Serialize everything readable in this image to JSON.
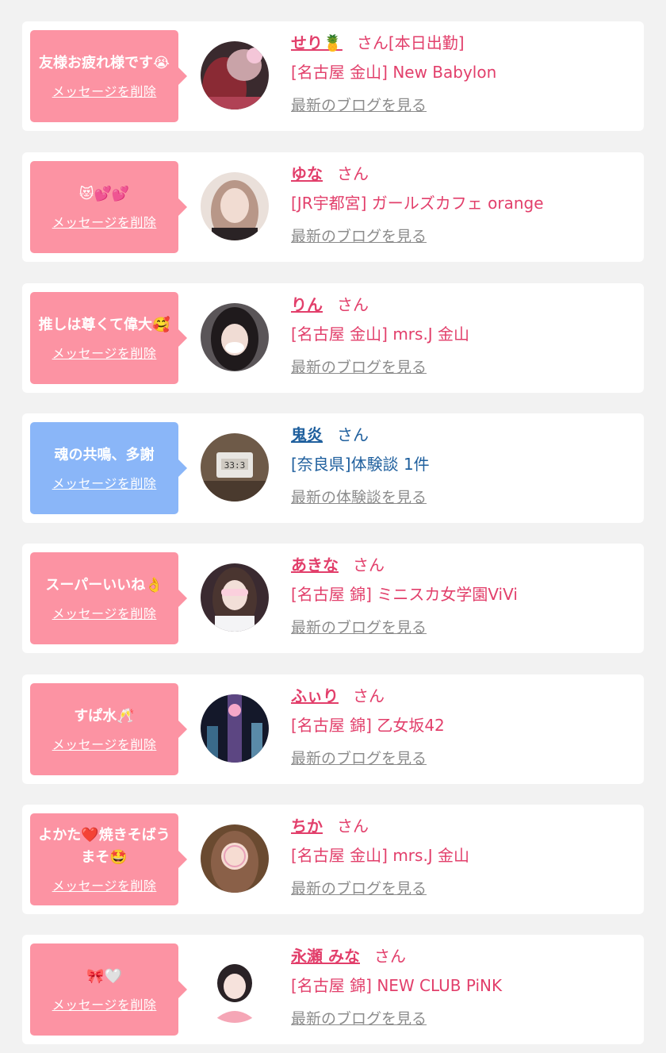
{
  "delete_label": "メッセージを削除",
  "colors": {
    "pink_bubble": "#fc93a3",
    "blue_bubble": "#8ab6f8",
    "pink_text": "#e23f6b",
    "blue_text": "#20609e",
    "link_gray": "#8c8c8c"
  },
  "items": [
    {
      "message": "友様お疲れ様です😭",
      "name": "せり🍍",
      "suffix": "さん[本日出勤]",
      "shop": "[名古屋 金山] New Babylon",
      "link": "最新のブログを見る",
      "theme": "pink",
      "avatar_icon": "girl-photo-red-hair"
    },
    {
      "message": "😻💕💕",
      "name": "ゆな",
      "suffix": "さん",
      "shop": "[JR宇都宮] ガールズカフェ orange",
      "link": "最新のブログを見る",
      "theme": "pink",
      "avatar_icon": "girl-photo-light"
    },
    {
      "message": "推しは尊くて偉大🥰",
      "name": "りん",
      "suffix": "さん",
      "shop": "[名古屋 金山] mrs.J 金山",
      "link": "最新のブログを見る",
      "theme": "pink",
      "avatar_icon": "girl-photo-dark-hair"
    },
    {
      "message": "魂の共鳴、多謝",
      "name": "鬼炎",
      "suffix": "さん",
      "shop": "[奈良県]体験談 1件",
      "link": "最新の体験談を見る",
      "theme": "blue",
      "avatar_icon": "clock-photo"
    },
    {
      "message": "スーパーいいね👌",
      "name": "あきな",
      "suffix": "さん",
      "shop": "[名古屋 錦] ミニスカ女学園ViVi",
      "link": "最新のブログを見る",
      "theme": "pink",
      "avatar_icon": "girl-photo-uniform"
    },
    {
      "message": "すぱ水🥂",
      "name": "ふぃり",
      "suffix": "さん",
      "shop": "[名古屋 錦] 乙女坂42",
      "link": "最新のブログを見る",
      "theme": "pink",
      "avatar_icon": "night-photo"
    },
    {
      "message": "よかた❤️焼きそばうまそ🤩",
      "name": "ちか",
      "suffix": "さん",
      "shop": "[名古屋 金山] mrs.J 金山",
      "link": "最新のブログを見る",
      "theme": "pink",
      "avatar_icon": "girl-photo-warm"
    },
    {
      "message": "🎀🤍",
      "name": "永瀬 みな",
      "suffix": "さん",
      "shop": "[名古屋 錦] NEW CLUB PiNK",
      "link": "最新のブログを見る",
      "theme": "pink",
      "avatar_icon": "girl-photo-pink"
    }
  ]
}
